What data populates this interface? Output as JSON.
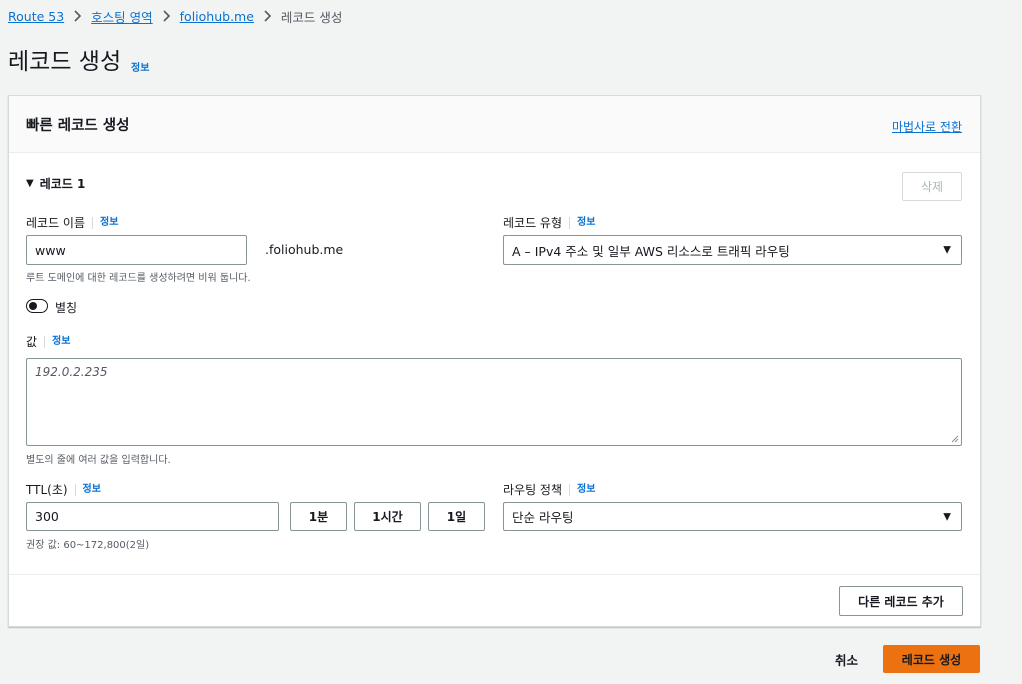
{
  "breadcrumb": {
    "items": [
      "Route 53",
      "호스팅 영역",
      "foliohub.me"
    ],
    "current": "레코드 생성"
  },
  "page": {
    "title": "레코드 생성",
    "info": "정보"
  },
  "panel": {
    "title": "빠른 레코드 생성",
    "wizard_link": "마법사로 전환"
  },
  "record": {
    "section_label": "레코드 1",
    "delete_label": "삭제",
    "name_label": "레코드 이름",
    "name_info": "정보",
    "name_value": "www",
    "domain_suffix": ".foliohub.me",
    "name_hint": "루트 도메인에 대한 레코드를 생성하려면 비워 둡니다.",
    "type_label": "레코드 유형",
    "type_info": "정보",
    "type_value": "A – IPv4 주소 및 일부 AWS 리소스로 트래픽 라우팅",
    "alias_label": "별칭",
    "value_label": "값",
    "value_info": "정보",
    "value_placeholder": "192.0.2.235",
    "value_hint": "별도의 줄에 여러 값을 입력합니다.",
    "ttl_label": "TTL(초)",
    "ttl_info": "정보",
    "ttl_value": "300",
    "ttl_buttons": [
      "1분",
      "1시간",
      "1일"
    ],
    "ttl_hint": "권장 값: 60~172,800(2일)",
    "routing_label": "라우팅 정책",
    "routing_info": "정보",
    "routing_value": "단순 라우팅"
  },
  "add_record_label": "다른 레코드 추가",
  "actions": {
    "cancel": "취소",
    "create": "레코드 생성"
  },
  "colors": {
    "link": "#0972d3",
    "primary": "#ec7211",
    "background": "#f2f3f3"
  }
}
